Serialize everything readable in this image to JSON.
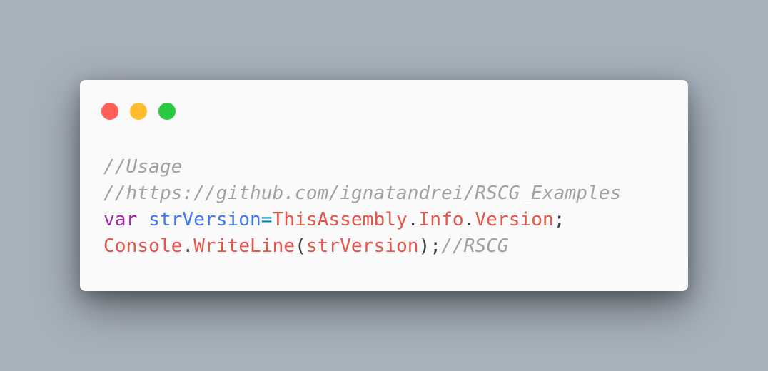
{
  "window": {
    "traffic_lights": [
      {
        "name": "close",
        "color": "#ff5f56"
      },
      {
        "name": "minimize",
        "color": "#ffbd2e"
      },
      {
        "name": "maximize",
        "color": "#27c93f"
      }
    ]
  },
  "code": {
    "colors": {
      "comment": "#a0a1a7",
      "keyword": "#a626a4",
      "variable": "#4078f2",
      "operator": "#0184bc",
      "identifier": "#e45649",
      "punctuation": "#383a42"
    },
    "lines": [
      [
        {
          "text": "//Usage",
          "kind": "comment"
        }
      ],
      [
        {
          "text": "//https://github.com/ignatandrei/RSCG_Examples",
          "kind": "comment"
        }
      ],
      [
        {
          "text": "var",
          "kind": "keyword"
        },
        {
          "text": " ",
          "kind": "punctuation"
        },
        {
          "text": "strVersion",
          "kind": "variable"
        },
        {
          "text": "=",
          "kind": "operator"
        },
        {
          "text": "ThisAssembly",
          "kind": "identifier"
        },
        {
          "text": ".",
          "kind": "punctuation"
        },
        {
          "text": "Info",
          "kind": "identifier"
        },
        {
          "text": ".",
          "kind": "punctuation"
        },
        {
          "text": "Version",
          "kind": "identifier"
        },
        {
          "text": ";",
          "kind": "punctuation"
        }
      ],
      [
        {
          "text": "Console",
          "kind": "identifier"
        },
        {
          "text": ".",
          "kind": "punctuation"
        },
        {
          "text": "WriteLine",
          "kind": "identifier"
        },
        {
          "text": "(",
          "kind": "punctuation"
        },
        {
          "text": "strVersion",
          "kind": "identifier"
        },
        {
          "text": ");",
          "kind": "punctuation"
        },
        {
          "text": "//RSCG",
          "kind": "comment"
        }
      ]
    ]
  }
}
